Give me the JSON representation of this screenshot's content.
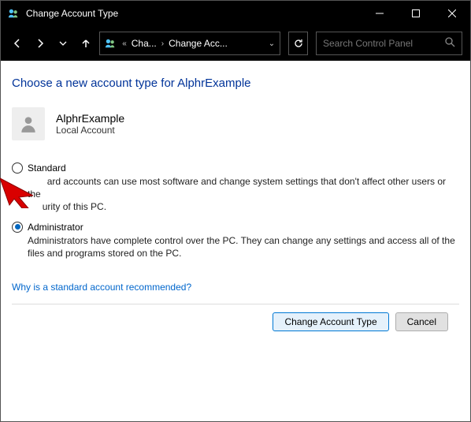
{
  "window": {
    "title": "Change Account Type"
  },
  "breadcrumb": {
    "seg1": "Cha...",
    "seg2": "Change Acc..."
  },
  "search": {
    "placeholder": "Search Control Panel"
  },
  "heading": "Choose a new account type for AlphrExample",
  "user": {
    "name": "AlphrExample",
    "type": "Local Account"
  },
  "options": {
    "standard": {
      "label": "Standard",
      "desc_prefix": "ard accounts can use most software and change system settings that don't affect other users or the",
      "desc_suffix": "urity of this PC."
    },
    "admin": {
      "label": "Administrator",
      "desc": "Administrators have complete control over the PC. They can change any settings and access all of the files and programs stored on the PC."
    }
  },
  "link": "Why is a standard account recommended?",
  "buttons": {
    "primary": "Change Account Type",
    "cancel": "Cancel"
  }
}
